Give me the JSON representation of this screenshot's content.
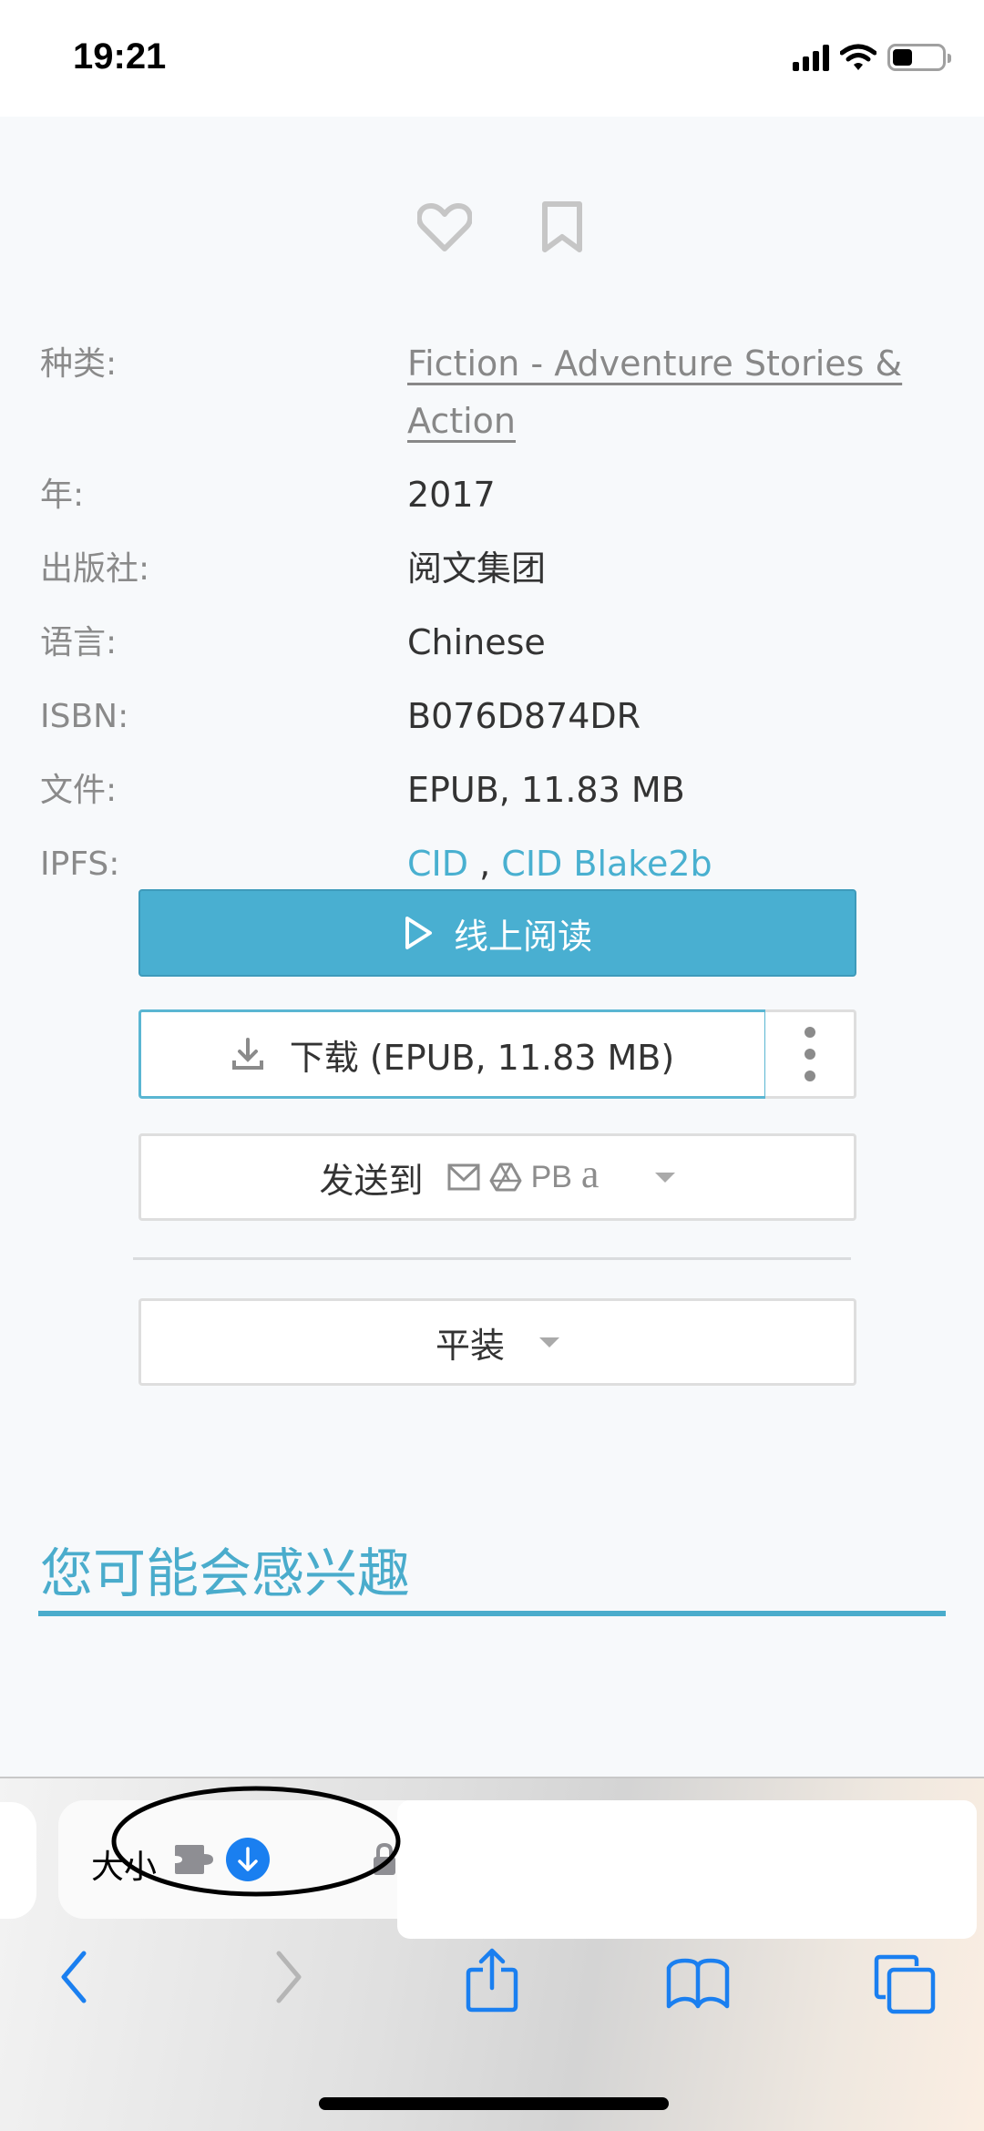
{
  "status_bar": {
    "time": "19:21",
    "icons": [
      "cellular-signal-icon",
      "wifi-icon",
      "battery-icon"
    ],
    "battery_level": 0.35
  },
  "actions": {
    "favorite_icon": "heart-outline-icon",
    "bookmark_icon": "bookmark-outline-icon"
  },
  "details": [
    {
      "label": "种类:",
      "value": "Fiction - Adventure Stories & Action",
      "type": "link"
    },
    {
      "label": "年:",
      "value": "2017",
      "type": "text"
    },
    {
      "label": "出版社:",
      "value": "阅文集团",
      "type": "text"
    },
    {
      "label": "语言:",
      "value": "Chinese",
      "type": "text"
    },
    {
      "label": "ISBN:",
      "value": "B076D874DR",
      "type": "text"
    },
    {
      "label": "文件:",
      "value": "EPUB, 11.83 MB",
      "type": "text"
    }
  ],
  "ipfs": {
    "label": "IPFS:",
    "links": [
      "CID",
      "CID Blake2b"
    ],
    "separator": ","
  },
  "buttons": {
    "read_online": "线上阅读",
    "download": "下载 (EPUB, 11.83 MB)",
    "send_to": "发送到",
    "send_targets": [
      "email-icon",
      "google-drive-icon",
      "PB",
      "a"
    ],
    "format": "平装"
  },
  "section": {
    "title": "您可能会感兴趣"
  },
  "browser": {
    "url_text": "大小",
    "toolbar": [
      "back",
      "forward",
      "share",
      "bookmarks",
      "tabs"
    ]
  },
  "colors": {
    "accent": "#49afd1",
    "link_gray": "#888888",
    "ios_blue": "#1a7ff0",
    "disabled_gray": "#b5b5b5"
  }
}
